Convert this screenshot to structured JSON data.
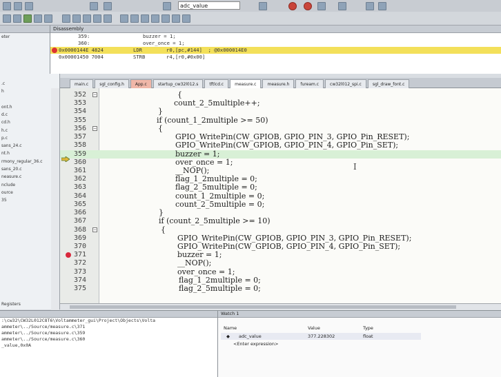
{
  "toolbar": {
    "combo_value": "adc_value"
  },
  "left_panel": {
    "items": [
      "eter",
      "",
      "",
      "",
      "",
      "",
      ".c",
      "h",
      "",
      "ont.h",
      "d.c",
      "cd.h",
      "h.c",
      "p.c",
      "sans_24.c",
      "nt.h",
      "rmony_regular_36.c",
      "sans_20.c",
      "neasure.c",
      "nclude",
      "ource",
      "35"
    ],
    "footer": "Registers"
  },
  "disassembly": {
    "title": "Disassembly",
    "lines": [
      {
        "num": "359:",
        "code": "buzzer = 1;"
      },
      {
        "num": "360:",
        "code": "over_once = 1;"
      },
      {
        "addr": "0x0000144E 4824",
        "op": "LDR",
        "arg": "r0,[pc,#144]  ; @0x000014E0",
        "highlight": true
      },
      {
        "addr": "0x00001450 7004",
        "op": "STRB",
        "arg": "r4,[r0,#0x00]"
      }
    ]
  },
  "tabs": [
    {
      "label": "main.c",
      "style": "normal"
    },
    {
      "label": "sgl_config.h",
      "style": "normal"
    },
    {
      "label": "App.c",
      "style": "red"
    },
    {
      "label": "startup_cw32l012.s",
      "style": "normal"
    },
    {
      "label": "tftlcd.c",
      "style": "normal"
    },
    {
      "label": "measure.c",
      "style": "active"
    },
    {
      "label": "measure.h",
      "style": "normal"
    },
    {
      "label": "fuream.c",
      "style": "normal"
    },
    {
      "label": "cw32l012_spi.c",
      "style": "normal"
    },
    {
      "label": "sgl_draw_font.c",
      "style": "normal"
    }
  ],
  "code": [
    {
      "ln": "352",
      "text": "{",
      "indent": 170,
      "fold": true
    },
    {
      "ln": "353",
      "text": "count_2_5multiple++;",
      "indent": 165
    },
    {
      "ln": "354",
      "text": "}",
      "indent": 142
    },
    {
      "ln": "355",
      "text": "if (count_1_2multiple >= 50)",
      "indent": 140
    },
    {
      "ln": "356",
      "text": "{",
      "indent": 142,
      "fold": true
    },
    {
      "ln": "357",
      "text": "GPIO_WritePin(CW_GPIOB, GPIO_PIN_3, GPIO_Pin_RESET);",
      "indent": 167
    },
    {
      "ln": "358",
      "text": "GPIO_WritePin(CW_GPIOB, GPIO_PIN_4, GPIO_Pin_SET);",
      "indent": 167
    },
    {
      "ln": "359",
      "text": "buzzer = 1;",
      "indent": 167,
      "current": true
    },
    {
      "ln": "360",
      "text": "over_once = 1;",
      "indent": 167
    },
    {
      "ln": "361",
      "text": "__NOP();",
      "indent": 167
    },
    {
      "ln": "362",
      "text": "flag_1_2multiple = 0;",
      "indent": 167
    },
    {
      "ln": "363",
      "text": "flag_2_5multiple = 0;",
      "indent": 167
    },
    {
      "ln": "364",
      "text": "count_1_2multiple = 0;",
      "indent": 167
    },
    {
      "ln": "365",
      "text": "count_2_5multiple = 0;",
      "indent": 167
    },
    {
      "ln": "366",
      "text": "}",
      "indent": 143
    },
    {
      "ln": "367",
      "text": "if (count_2_5multiple >= 10)",
      "indent": 143
    },
    {
      "ln": "368",
      "text": "{",
      "indent": 146,
      "fold": true
    },
    {
      "ln": "369",
      "text": "GPIO_WritePin(CW_GPIOB, GPIO_PIN_3, GPIO_Pin_RESET);",
      "indent": 170
    },
    {
      "ln": "370",
      "text": "GPIO_WritePin(CW_GPIOB, GPIO_PIN_4, GPIO_Pin_SET);",
      "indent": 170
    },
    {
      "ln": "371",
      "text": "buzzer = 1;",
      "indent": 170,
      "breakpoint": true
    },
    {
      "ln": "372",
      "text": "__NOP();",
      "indent": 170
    },
    {
      "ln": "373",
      "text": "over_once = 1;",
      "indent": 170
    },
    {
      "ln": "374",
      "text": "flag_1_2multiple = 0;",
      "indent": 172
    },
    {
      "ln": "375",
      "text": "flag_2_5multiple = 0;",
      "indent": 172
    }
  ],
  "build_output": {
    "lines": [
      ":\\cw32\\CW32L012C8T6\\Voltammeter_gui\\Project\\Objects\\Volta",
      "ammeter\\../Source/measure.c\\371",
      "ammeter\\../Source/measure.c\\359",
      "ammeter\\../Source/measure.c\\360",
      "_value,0x0A"
    ]
  },
  "watch": {
    "title": "Watch 1",
    "headers": {
      "name": "Name",
      "value": "Value",
      "type": "Type"
    },
    "rows": [
      {
        "name": "adc_value",
        "value": "377.228302",
        "type": "float"
      },
      {
        "name": "<Enter expression>",
        "value": "",
        "type": ""
      }
    ]
  }
}
